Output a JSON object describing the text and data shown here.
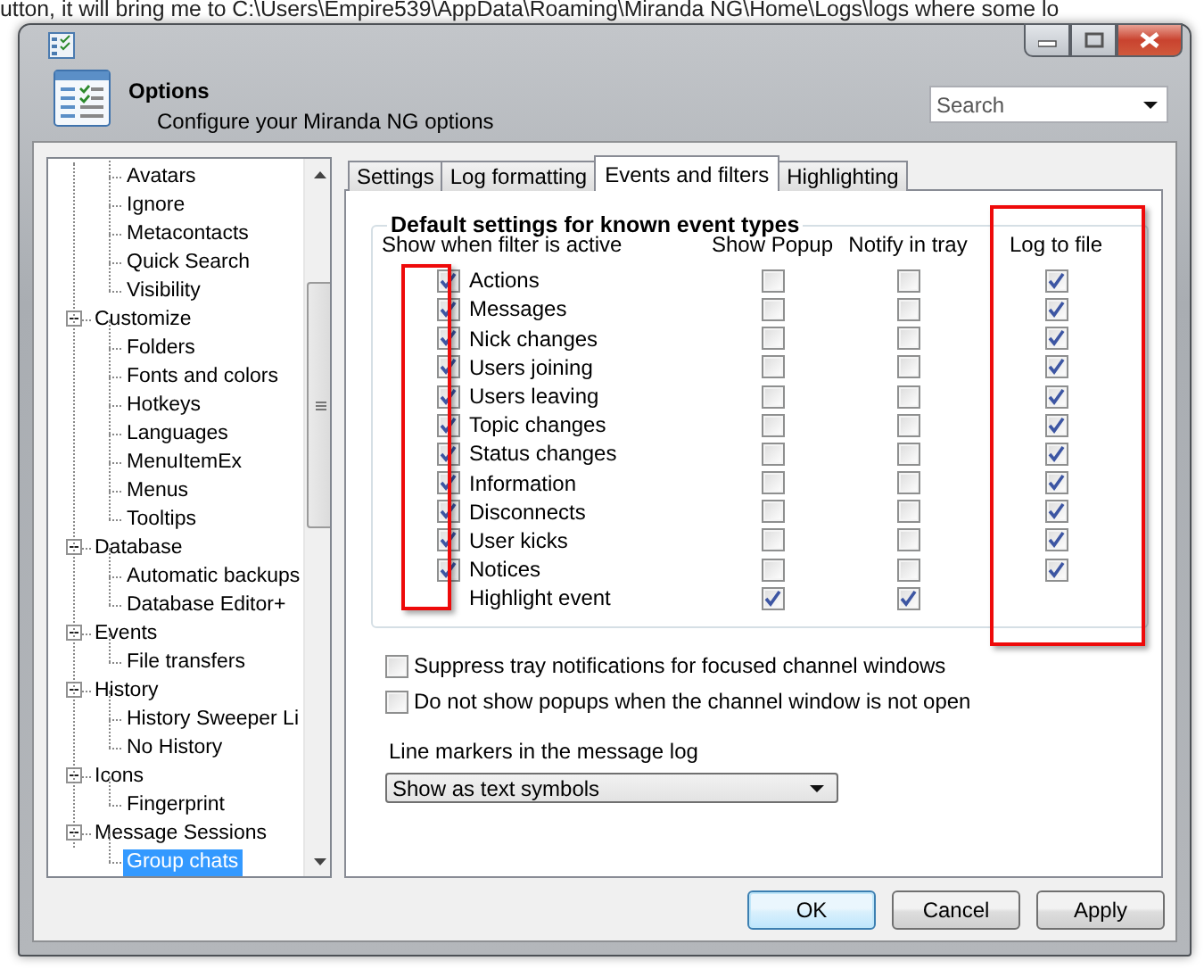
{
  "background": {
    "text": "utton, it will bring me to C:\\Users\\Empire539\\AppData\\Roaming\\Miranda NG\\Home\\Logs\\logs where some lo"
  },
  "window": {
    "caption_buttons": [
      {
        "kind": "minimize"
      },
      {
        "kind": "maximize"
      },
      {
        "kind": "close"
      }
    ],
    "title": "Options",
    "subtitle": "Configure your Miranda NG options",
    "search": {
      "placeholder": "Search"
    }
  },
  "tree": {
    "items": [
      {
        "children": [
          {
            "label": "Avatars",
            "selected": false
          },
          {
            "label": "Ignore",
            "selected": false
          },
          {
            "label": "Metacontacts",
            "selected": false
          },
          {
            "label": "Quick Search",
            "selected": false
          },
          {
            "label": "Visibility",
            "selected": false
          }
        ]
      },
      {
        "label": "Customize",
        "expanded": true,
        "selected": false,
        "children": [
          {
            "label": "Folders",
            "selected": false
          },
          {
            "label": "Fonts and colors",
            "selected": false
          },
          {
            "label": "Hotkeys",
            "selected": false
          },
          {
            "label": "Languages",
            "selected": false
          },
          {
            "label": "MenuItemEx",
            "selected": false
          },
          {
            "label": "Menus",
            "selected": false
          },
          {
            "label": "Tooltips",
            "selected": false
          }
        ]
      },
      {
        "label": "Database",
        "expanded": true,
        "selected": false,
        "children": [
          {
            "label": "Automatic backups",
            "selected": false
          },
          {
            "label": "Database Editor+",
            "selected": false
          }
        ]
      },
      {
        "label": "Events",
        "expanded": true,
        "selected": false,
        "children": [
          {
            "label": "File transfers",
            "selected": false
          }
        ]
      },
      {
        "label": "History",
        "expanded": true,
        "selected": false,
        "children": [
          {
            "label": "History Sweeper Li",
            "selected": false
          },
          {
            "label": "No History",
            "selected": false
          }
        ]
      },
      {
        "label": "Icons",
        "expanded": true,
        "selected": false,
        "children": [
          {
            "label": "Fingerprint",
            "selected": false
          }
        ]
      },
      {
        "label": "Message Sessions",
        "expanded": true,
        "selected": false,
        "children": [
          {
            "label": "Group chats",
            "selected": true
          }
        ]
      }
    ]
  },
  "tabs": [
    {
      "label": "Settings",
      "selected": false
    },
    {
      "label": "Log formatting",
      "selected": false
    },
    {
      "label": "Events and filters",
      "selected": true
    },
    {
      "label": "Highlighting",
      "selected": false
    }
  ],
  "events": {
    "title": "Default settings for known event types",
    "columns": [
      "Show when filter is active",
      "Show Popup",
      "Notify in tray",
      "Log to file"
    ],
    "rows": [
      {
        "label": "Actions",
        "show": true,
        "popup": false,
        "tray": false,
        "log": true
      },
      {
        "label": "Messages",
        "show": true,
        "popup": false,
        "tray": false,
        "log": true
      },
      {
        "label": "Nick changes",
        "show": true,
        "popup": false,
        "tray": false,
        "log": true
      },
      {
        "label": "Users joining",
        "show": true,
        "popup": false,
        "tray": false,
        "log": true
      },
      {
        "label": "Users leaving",
        "show": true,
        "popup": false,
        "tray": false,
        "log": true
      },
      {
        "label": "Topic changes",
        "show": true,
        "popup": false,
        "tray": false,
        "log": true
      },
      {
        "label": "Status changes",
        "show": true,
        "popup": false,
        "tray": false,
        "log": true
      },
      {
        "label": "Information",
        "show": true,
        "popup": false,
        "tray": false,
        "log": true
      },
      {
        "label": "Disconnects",
        "show": true,
        "popup": false,
        "tray": false,
        "log": true
      },
      {
        "label": "User kicks",
        "show": true,
        "popup": false,
        "tray": false,
        "log": true
      },
      {
        "label": "Notices",
        "show": true,
        "popup": false,
        "tray": false,
        "log": true
      },
      {
        "label": "Highlight event",
        "popup": true,
        "tray": true
      }
    ]
  },
  "options": [
    {
      "label": "Suppress tray notifications for focused channel windows",
      "checked": false
    },
    {
      "label": "Do not show popups when the channel window is not open",
      "checked": false
    }
  ],
  "line_markers": {
    "label": "Line markers in the message log",
    "value": "Show as text symbols"
  },
  "buttons": [
    {
      "label": "OK",
      "default": true
    },
    {
      "label": "Cancel",
      "default": false
    },
    {
      "label": "Apply",
      "default": false
    }
  ],
  "annotations": [
    {
      "kind": "rectangle"
    },
    {
      "kind": "rectangle"
    }
  ]
}
